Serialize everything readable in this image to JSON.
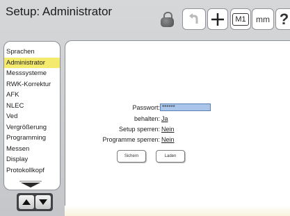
{
  "window": {
    "title": "Setup: Administrator"
  },
  "toolbar": {
    "m1_label": "M1",
    "mm_label": "mm",
    "help_label": "?"
  },
  "sidebar": {
    "items": [
      {
        "label": "Sprachen",
        "selected": false
      },
      {
        "label": "Administrator",
        "selected": true
      },
      {
        "label": "Messsysteme",
        "selected": false
      },
      {
        "label": "RWK-Korrektur",
        "selected": false
      },
      {
        "label": "AFK",
        "selected": false
      },
      {
        "label": "NLEC",
        "selected": false
      },
      {
        "label": "Ved",
        "selected": false
      },
      {
        "label": "Vergrößerung",
        "selected": false
      },
      {
        "label": "Programming",
        "selected": false
      },
      {
        "label": "Messen",
        "selected": false
      },
      {
        "label": "Display",
        "selected": false
      },
      {
        "label": "Protokollkopf",
        "selected": false
      }
    ]
  },
  "form": {
    "password_label": "Passwort:",
    "password_value": "******",
    "keep_label": "behalten:",
    "keep_value": "Ja",
    "setup_lock_label": "Setup sperren:",
    "setup_lock_value": "Nein",
    "programs_lock_label": "Programme sperren:",
    "programs_lock_value": "Nein",
    "save_label": "Sichern",
    "load_label": "Laden"
  },
  "colors": {
    "selected_bg": "#f4ea6e",
    "input_bg": "#a9c6ea",
    "chrome_bg": "#c9cbce"
  }
}
